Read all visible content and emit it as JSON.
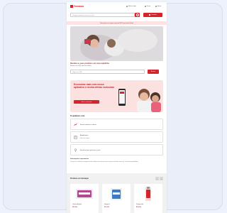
{
  "header": {
    "logo_text": "Farmácia",
    "links": [
      {
        "label": "Minhas lojas",
        "icon": "store-icon"
      },
      {
        "label": "Entrar",
        "icon": "user-icon"
      },
      {
        "label": "Ajuda",
        "icon": "help-icon"
      }
    ],
    "search_placeholder": "Pesquise produtos, marcas e mais...",
    "cta_label": "Carrinho"
  },
  "promo_banner": "Frete grátis em compras acima de R$ 99 para todo o Brasil",
  "hero": {
    "title": "Receba os seus produtos em casa rapidinho",
    "subtitle": "Informe seu CEP para ver ofertas",
    "input_placeholder": "Digite seu CEP",
    "button_label": "Buscar"
  },
  "app_promo": {
    "title": "Economize mais com nosso aplicativo e receba ofertas exclusivas",
    "button_label": "Baixar o aplicativo"
  },
  "help": {
    "title": "Te ajudamos com:",
    "items": [
      {
        "label": "Buscar produtos e ofertas",
        "icon": "chart-icon"
      },
      {
        "label": "Atendimento",
        "sublabel": "Fale com a gente",
        "icon": "document-icon"
      },
      {
        "label": "Encontrar lojas próximas a você",
        "icon": "location-icon"
      }
    ]
  },
  "info": {
    "title": "Informações importantes",
    "text": "Os preços e condições de pagamento são válidos exclusivamente para compras realizadas neste site. Consulte disponibilidade."
  },
  "products": {
    "title": "Produtos em destaque",
    "prev": "‹",
    "next": "›",
    "items": [
      {
        "name": "Creme hidratante",
        "price": "R$ 29,90",
        "color": "#b04a8c"
      },
      {
        "name": "Vitamina C",
        "price": "R$ 19,90",
        "color": "#3a7bc8"
      },
      {
        "name": "Protetor solar",
        "price": "R$ 49,90",
        "color": "#d8232a"
      }
    ]
  },
  "colors": {
    "brand": "#d8232a",
    "promo_bg": "#fde3e3",
    "app_bg": "#fbe2e0"
  }
}
